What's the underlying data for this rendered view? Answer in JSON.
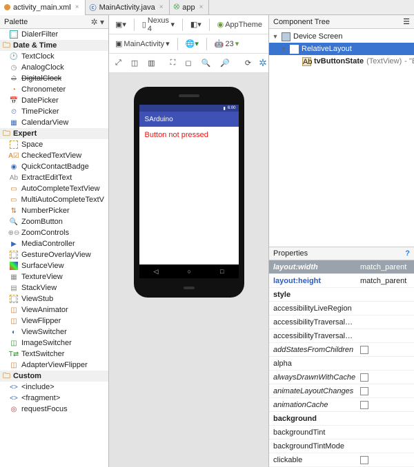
{
  "tabs": [
    {
      "label": "activity_main.xml",
      "icon": "dot-orange"
    },
    {
      "label": "MainActivity.java",
      "icon": "java"
    },
    {
      "label": "app",
      "icon": "app"
    }
  ],
  "palette": {
    "title": "Palette",
    "first_item": "DialerFilter",
    "categories": [
      {
        "name": "Date & Time",
        "items": [
          {
            "label": "TextClock"
          },
          {
            "label": "AnalogClock"
          },
          {
            "label": "DigitalClock",
            "strike": true
          },
          {
            "label": "Chronometer"
          },
          {
            "label": "DatePicker"
          },
          {
            "label": "TimePicker"
          },
          {
            "label": "CalendarView"
          }
        ]
      },
      {
        "name": "Expert",
        "items": [
          {
            "label": "Space"
          },
          {
            "label": "CheckedTextView"
          },
          {
            "label": "QuickContactBadge"
          },
          {
            "label": "ExtractEditText"
          },
          {
            "label": "AutoCompleteTextView"
          },
          {
            "label": "MultiAutoCompleteTextV"
          },
          {
            "label": "NumberPicker"
          },
          {
            "label": "ZoomButton"
          },
          {
            "label": "ZoomControls"
          },
          {
            "label": "MediaController"
          },
          {
            "label": "GestureOverlayView"
          },
          {
            "label": "SurfaceView"
          },
          {
            "label": "TextureView"
          },
          {
            "label": "StackView"
          },
          {
            "label": "ViewStub"
          },
          {
            "label": "ViewAnimator"
          },
          {
            "label": "ViewFlipper"
          },
          {
            "label": "ViewSwitcher"
          },
          {
            "label": "ImageSwitcher"
          },
          {
            "label": "TextSwitcher"
          },
          {
            "label": "AdapterViewFlipper"
          }
        ]
      },
      {
        "name": "Custom",
        "items": [
          {
            "label": "<include>"
          },
          {
            "label": "<fragment>"
          },
          {
            "label": "requestFocus"
          }
        ]
      }
    ]
  },
  "designer": {
    "device": "Nexus 4",
    "theme": "AppTheme",
    "activity": "MainActivity",
    "api": "23",
    "app_title": "SArduino",
    "status_time": "6:00",
    "screen_text": "Button not pressed"
  },
  "component_tree": {
    "title": "Component Tree",
    "root": "Device Screen",
    "layout": "RelativeLayout",
    "child_name": "tvButtonState",
    "child_type": "(TextView)",
    "child_extra": " - \"B"
  },
  "properties": {
    "title": "Properties",
    "rows": [
      {
        "name": "layout:width",
        "value": "match_parent",
        "style": "header"
      },
      {
        "name": "layout:height",
        "value": "match_parent",
        "style": "blue"
      },
      {
        "name": "style",
        "value": "",
        "style": "bold"
      },
      {
        "name": "accessibilityLiveRegion",
        "value": ""
      },
      {
        "name": "accessibilityTraversalAfte",
        "value": ""
      },
      {
        "name": "accessibilityTraversalBefo",
        "value": ""
      },
      {
        "name": "addStatesFromChildren",
        "value": "",
        "style": "italic",
        "checkbox": true
      },
      {
        "name": "alpha",
        "value": ""
      },
      {
        "name": "alwaysDrawnWithCache",
        "value": "",
        "style": "italic",
        "checkbox": true
      },
      {
        "name": "animateLayoutChanges",
        "value": "",
        "style": "italic",
        "checkbox": true
      },
      {
        "name": "animationCache",
        "value": "",
        "style": "italic",
        "checkbox": true
      },
      {
        "name": "background",
        "value": "",
        "style": "bold"
      },
      {
        "name": "backgroundTint",
        "value": ""
      },
      {
        "name": "backgroundTintMode",
        "value": ""
      },
      {
        "name": "clickable",
        "value": "",
        "checkbox": true
      }
    ]
  }
}
